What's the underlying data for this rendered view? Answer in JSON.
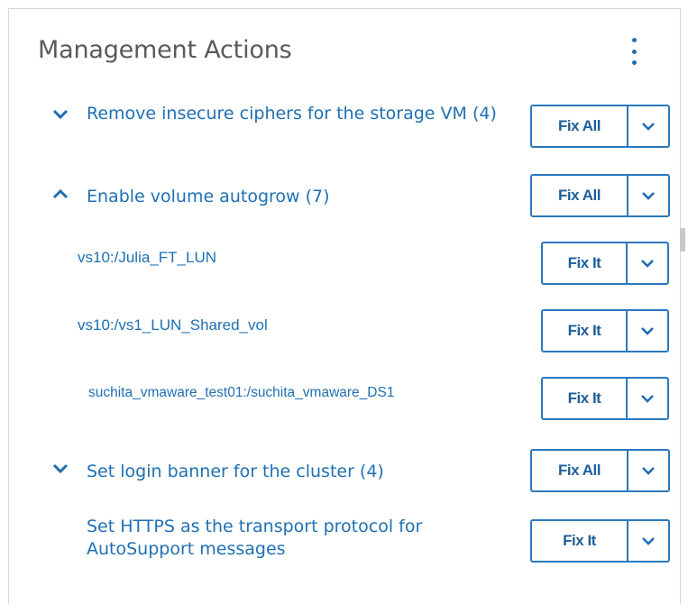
{
  "panel": {
    "title": "Management Actions",
    "menu_icon": "kebab-menu-icon"
  },
  "actions": [
    {
      "label": "Remove insecure ciphers for the storage VM (4)",
      "expanded": false,
      "button": "Fix All"
    },
    {
      "label": "Enable volume autogrow (7)",
      "expanded": true,
      "button": "Fix All",
      "items": [
        {
          "label": "vs10:/Julia_FT_LUN",
          "button": "Fix It"
        },
        {
          "label": "vs10:/vs1_LUN_Shared_vol",
          "button": "Fix It"
        },
        {
          "label": "suchita_vmaware_test01:/suchita_vmaware_DS1",
          "button": "Fix It"
        }
      ]
    },
    {
      "label": "Set login banner for the cluster (4)",
      "expanded": false,
      "button": "Fix All"
    },
    {
      "label": "Set HTTPS as the transport protocol for AutoSupport messages",
      "button": "Fix It"
    }
  ],
  "colors": {
    "accent": "#1f6fb2",
    "border": "#2a78bd",
    "title": "#5a5a5a"
  }
}
